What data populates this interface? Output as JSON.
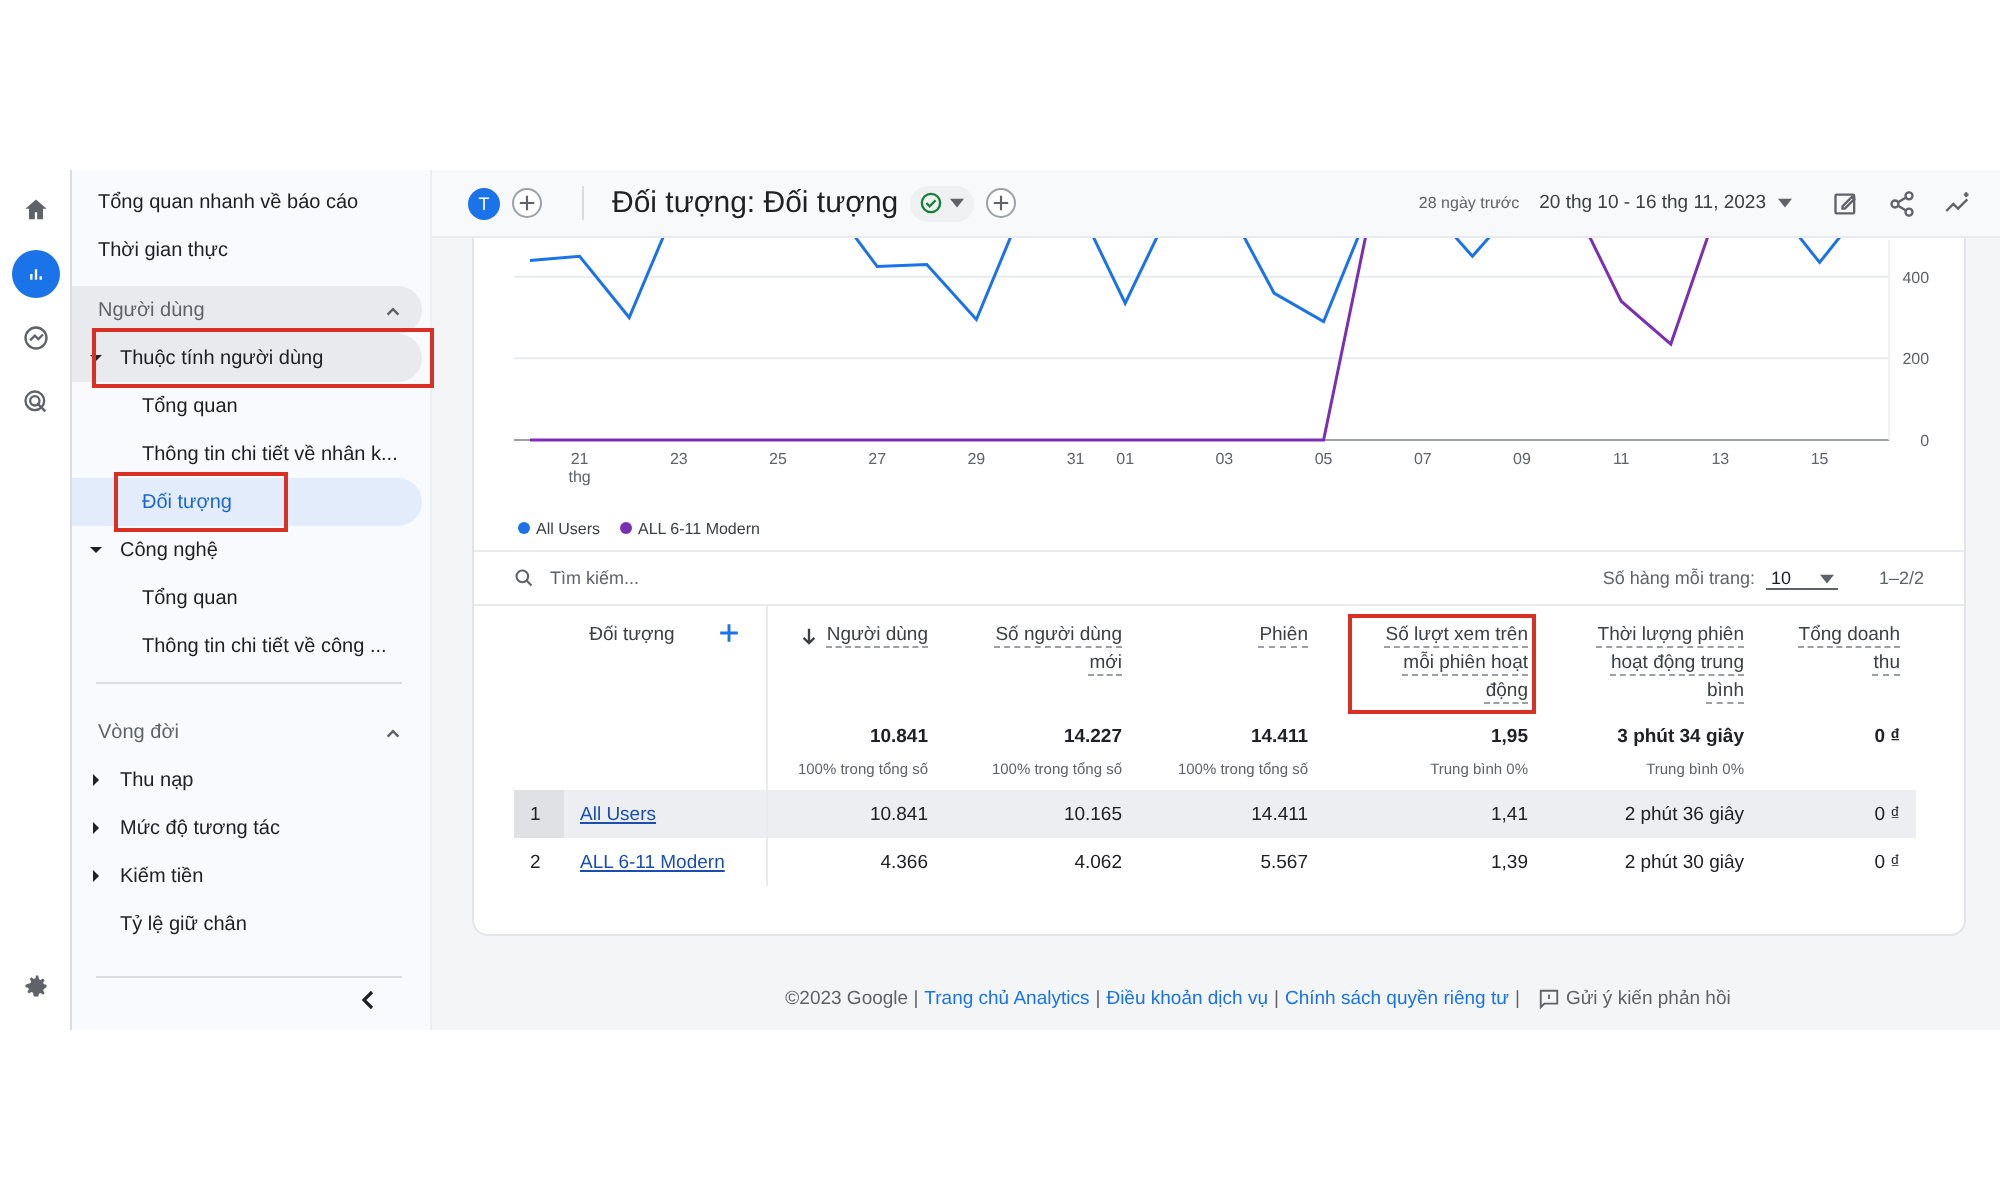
{
  "nav_rail": {
    "items": [
      {
        "kind": "home",
        "selected": false
      },
      {
        "kind": "reports",
        "selected": true
      },
      {
        "kind": "explore",
        "selected": false
      },
      {
        "kind": "advertising",
        "selected": false
      }
    ],
    "settings": {
      "kind": "settings"
    }
  },
  "sidebar": {
    "groups": [
      {
        "items": [
          {
            "kind": "link",
            "label": "Tổng quan nhanh về báo cáo",
            "selected": false,
            "annotated": false
          },
          {
            "kind": "link",
            "label": "Thời gian thực",
            "selected": false,
            "annotated": false
          }
        ]
      },
      {
        "header": "Người dùng",
        "expanded": true,
        "items": [
          {
            "kind": "folder",
            "label": "Thuộc tính người dùng",
            "expanded": true,
            "hovered": true,
            "annotated": true,
            "children": [
              {
                "kind": "link",
                "label": "Tổng quan",
                "selected": false,
                "annotated": false
              },
              {
                "kind": "link",
                "label": "Thông tin chi tiết về nhân k...",
                "selected": false,
                "annotated": false
              },
              {
                "kind": "link",
                "label": "Đối tượng",
                "selected": true,
                "annotated": true
              }
            ]
          },
          {
            "kind": "folder",
            "label": "Công nghệ",
            "expanded": true,
            "hovered": false,
            "annotated": false,
            "children": [
              {
                "kind": "link",
                "label": "Tổng quan",
                "selected": false,
                "annotated": false
              },
              {
                "kind": "link",
                "label": "Thông tin chi tiết về công ...",
                "selected": false,
                "annotated": false
              }
            ]
          }
        ]
      },
      {
        "header": "Vòng đời",
        "expanded": true,
        "items": [
          {
            "kind": "folder",
            "label": "Thu nạp",
            "expanded": false,
            "hovered": false,
            "annotated": false
          },
          {
            "kind": "folder",
            "label": "Mức độ tương tác",
            "expanded": false,
            "hovered": false,
            "annotated": false
          },
          {
            "kind": "folder",
            "label": "Kiếm tiền",
            "expanded": false,
            "hovered": false,
            "annotated": false
          },
          {
            "kind": "link",
            "label": "Tỷ lệ giữ chân",
            "selected": false,
            "annotated": false
          }
        ]
      }
    ]
  },
  "top_bar": {
    "avatar": "T",
    "title": "Đối tượng: Đối tượng",
    "date_hint": "28 ngày trước",
    "date_range": "20 thg 10 - 16 thg 11, 2023"
  },
  "chart_data": {
    "type": "line",
    "categories": [
      null,
      "21 thg",
      null,
      "23",
      null,
      "25",
      null,
      "27",
      null,
      "29",
      null,
      "31",
      "01",
      null,
      "03",
      null,
      "05",
      null,
      "07",
      null,
      "09",
      null,
      "11",
      null,
      "13",
      null,
      "15",
      null
    ],
    "yticks": [
      0,
      200,
      400
    ],
    "ylim": [
      0,
      490
    ],
    "series": [
      {
        "name": "All Users",
        "color": "#1a73e8",
        "values": [
          440,
          450,
          300,
          null,
          null,
          null,
          null,
          425,
          430,
          295,
          null,
          null,
          335,
          null,
          null,
          360,
          290,
          null,
          null,
          450,
          null,
          null,
          null,
          null,
          null,
          null,
          435,
          null
        ]
      },
      {
        "name": "ALL 6-11 Modern",
        "color": "#7b2fb5",
        "values": [
          0,
          0,
          0,
          0,
          0,
          0,
          0,
          0,
          0,
          0,
          0,
          0,
          0,
          0,
          0,
          0,
          0,
          null,
          null,
          null,
          null,
          null,
          340,
          235,
          null,
          null,
          null,
          null
        ]
      }
    ]
  },
  "table": {
    "search": {
      "placeholder": "Tìm kiếm..."
    },
    "rows_per_page_label": "Số hàng mỗi trang:",
    "rows_per_page": "10",
    "range": "1–2/2",
    "columns": [
      {
        "label": "Đối tượng",
        "sorted": false,
        "annotated": false
      },
      {
        "label": "Người dùng",
        "sorted": true,
        "annotated": false
      },
      {
        "label": "Số người dùng mới",
        "sorted": false,
        "annotated": false
      },
      {
        "label": "Phiên",
        "sorted": false,
        "annotated": false
      },
      {
        "label": "Số lượt xem trên mỗi phiên hoạt động",
        "sorted": false,
        "annotated": true
      },
      {
        "label": "Thời lượng phiên hoạt động trung bình",
        "sorted": false,
        "annotated": false
      },
      {
        "label": "Tổng doanh thu",
        "sorted": false,
        "annotated": false
      }
    ],
    "totals": [
      {
        "value": "10.841",
        "note": "100% trong tổng số"
      },
      {
        "value": "14.227",
        "note": "100% trong tổng số"
      },
      {
        "value": "14.411",
        "note": "100% trong tổng số"
      },
      {
        "value": "1,95",
        "note": "Trung bình 0%"
      },
      {
        "value": "3 phút 34 giây",
        "note": "Trung bình 0%"
      },
      {
        "value": "0 ₫"
      }
    ],
    "rows": [
      {
        "index": "1",
        "highlighted": true,
        "cells": [
          "All Users",
          "10.841",
          "10.165",
          "14.411",
          "1,41",
          "2 phút 36 giây",
          "0 ₫"
        ]
      },
      {
        "index": "2",
        "highlighted": false,
        "cells": [
          "ALL 6-11 Modern",
          "4.366",
          "4.062",
          "5.567",
          "1,39",
          "2 phút 30 giây",
          "0 ₫"
        ]
      }
    ]
  },
  "footer": {
    "parts": [
      {
        "kind": "text",
        "text": "©2023 Google |"
      },
      {
        "kind": "link",
        "text": "Trang chủ Analytics"
      },
      {
        "kind": "text",
        "text": "|"
      },
      {
        "kind": "link",
        "text": "Điều khoản dịch vụ"
      },
      {
        "kind": "text",
        "text": "|"
      },
      {
        "kind": "link",
        "text": "Chính sách quyền riêng tư"
      },
      {
        "kind": "text",
        "text": "|"
      }
    ],
    "feedback": "Gửi ý kiến phản hồi"
  }
}
